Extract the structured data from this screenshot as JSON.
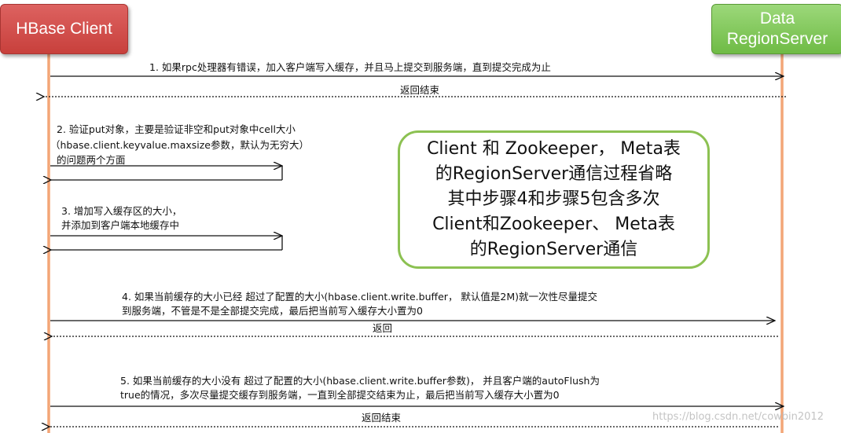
{
  "actors": {
    "client": "HBase Client",
    "server_line1": "Data",
    "server_line2": "RegionServer"
  },
  "messages": {
    "m1": "1. 如果rpc处理器有错误，加入客户端写入缓存，并且马上提交到服务端，直到提交完成为止",
    "r1": "返回结束",
    "m2_line1": "2. 验证put对象，主要是验证非空和put对象中cell大小",
    "m2_line2": "（hbase.client.keyvalue.maxsize参数，默认为无穷大）",
    "m2_line3": "的问题两个方面",
    "m3_line1": "3. 增加写入缓存区的大小，",
    "m3_line2": "并添加到客户端本地缓存中",
    "m4_line1": "4. 如果当前缓存的大小已经 超过了配置的大小(hbase.client.write.buffer，  默认值是2M)就一次性尽量提交",
    "m4_line2": "到服务端，不管是不是全部提交完成，最后把当前写入缓存大小置为0",
    "r4": "返回",
    "m5_line1": "5. 如果当前缓存的大小没有 超过了配置的大小(hbase.client.write.buffer参数)，  并且客户端的autoFlush为",
    "m5_line2": "true的情况，多次尽量提交缓存到服务端，一直到全部提交结束为止，最后把当前写入缓存大小置为0",
    "r5": "返回结束"
  },
  "note": {
    "line1": "Client 和 Zookeeper， Meta表",
    "line2": "的RegionServer通信过程省略",
    "line3": "其中步骤4和步骤5包含多次",
    "line4": "Client和Zookeeper、 Meta表",
    "line5": "的RegionServer通信"
  },
  "watermark": "https://blog.csdn.net/cowbin2012",
  "colors": {
    "lifeline": "#f3a677",
    "client_box": "#cc4440",
    "server_box": "#7bc24f",
    "note_border": "#8cc152",
    "arrow": "#111111"
  }
}
